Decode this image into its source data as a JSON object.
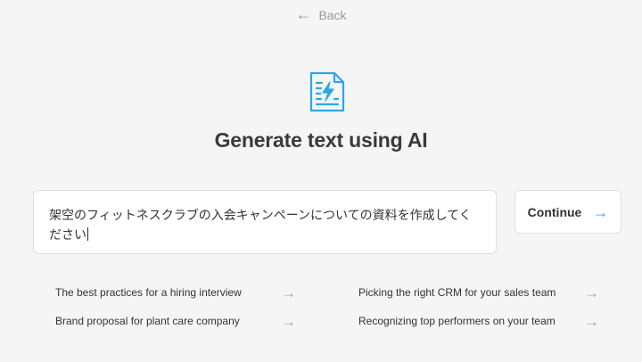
{
  "nav": {
    "back_label": "Back",
    "back_icon": "←"
  },
  "header": {
    "icon": "document-lightning-icon",
    "title": "Generate text using AI"
  },
  "prompt": {
    "value": "架空のフィットネスクラブの入会キャンペーンについての資料を作成してください"
  },
  "continue": {
    "label": "Continue",
    "icon": "→"
  },
  "suggestions": [
    {
      "label": "The best practices for a hiring interview",
      "icon": "→"
    },
    {
      "label": "Picking the right CRM for your sales team",
      "icon": "→"
    },
    {
      "label": "Brand proposal for plant care company",
      "icon": "→"
    },
    {
      "label": "Recognizing top performers on your team",
      "icon": "→"
    }
  ],
  "colors": {
    "accent": "#29a9e6",
    "background": "#f5f5f5",
    "text": "#333333"
  }
}
